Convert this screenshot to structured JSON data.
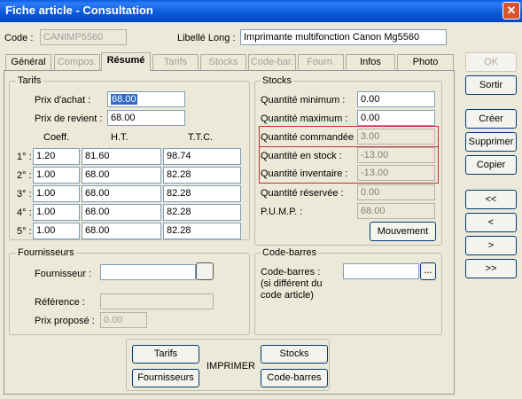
{
  "window": {
    "title": "Fiche article - Consultation",
    "close_glyph": "✕"
  },
  "header": {
    "code_label": "Code :",
    "code_value": "CANIMP5560",
    "libelle_label": "Libellé Long :",
    "libelle_value": "Imprimante multifonction Canon Mg5560"
  },
  "tabs": [
    {
      "label": "Général",
      "enabled": true
    },
    {
      "label": "Compos.",
      "enabled": false
    },
    {
      "label": "Résumé",
      "enabled": true,
      "active": true
    },
    {
      "label": "Tarifs",
      "enabled": false
    },
    {
      "label": "Stocks",
      "enabled": false
    },
    {
      "label": "Code-bar.",
      "enabled": false
    },
    {
      "label": "Fourn.",
      "enabled": false
    },
    {
      "label": "Infos",
      "enabled": true
    },
    {
      "label": "Photo",
      "enabled": true
    }
  ],
  "tarifs": {
    "group_label": "Tarifs",
    "prix_achat_label": "Prix d'achat :",
    "prix_achat_value": "68.00",
    "prix_revient_label": "Prix de revient :",
    "prix_revient_value": "68.00",
    "col_coeff": "Coeff.",
    "col_ht": "H.T.",
    "col_ttc": "T.T.C.",
    "rows": [
      {
        "label": "1° :",
        "coeff": "1.20",
        "ht": "81.60",
        "ttc": "98.74"
      },
      {
        "label": "2° :",
        "coeff": "1.00",
        "ht": "68.00",
        "ttc": "82.28"
      },
      {
        "label": "3° :",
        "coeff": "1.00",
        "ht": "68.00",
        "ttc": "82.28"
      },
      {
        "label": "4° :",
        "coeff": "1.00",
        "ht": "68.00",
        "ttc": "82.28"
      },
      {
        "label": "5° :",
        "coeff": "1.00",
        "ht": "68.00",
        "ttc": "82.28"
      }
    ]
  },
  "stocks": {
    "group_label": "Stocks",
    "qte_min_label": "Quantité minimum :",
    "qte_min_value": "0.00",
    "qte_max_label": "Quantité maximum :",
    "qte_max_value": "0.00",
    "qte_cmd_label": "Quantité commandée :",
    "qte_cmd_value": "3.00",
    "qte_stock_label": "Quantité en stock :",
    "qte_stock_value": "-13.00",
    "qte_inv_label": "Quantité inventaire :",
    "qte_inv_value": "-13.00",
    "qte_res_label": "Quantité réservée :",
    "qte_res_value": "0.00",
    "pump_label": "P.U.M.P. :",
    "pump_value": "68.00",
    "mouvement_button": "Mouvement"
  },
  "fournisseurs": {
    "group_label": "Fournisseurs",
    "fournisseur_label": "Fournisseur :",
    "fournisseur_value": "",
    "reference_label": "Référence :",
    "reference_value": "",
    "prix_propose_label": "Prix proposé :",
    "prix_propose_value": "0.00"
  },
  "codebarres": {
    "group_label": "Code-barres",
    "label_line1": "Code-barres :",
    "label_line2": "(si différent du",
    "label_line3": "code article)",
    "value": "",
    "browse_button": "..."
  },
  "imprimer": {
    "label": "IMPRIMER",
    "tarifs_button": "Tarifs",
    "fournisseurs_button": "Fournisseurs",
    "stocks_button": "Stocks",
    "codebarres_button": "Code-barres"
  },
  "side": {
    "ok": "OK",
    "sortir": "Sortir",
    "creer": "Créer",
    "supprimer": "Supprimer",
    "copier": "Copier",
    "first": "<<",
    "prev": "<",
    "next": ">",
    "last": ">>"
  }
}
